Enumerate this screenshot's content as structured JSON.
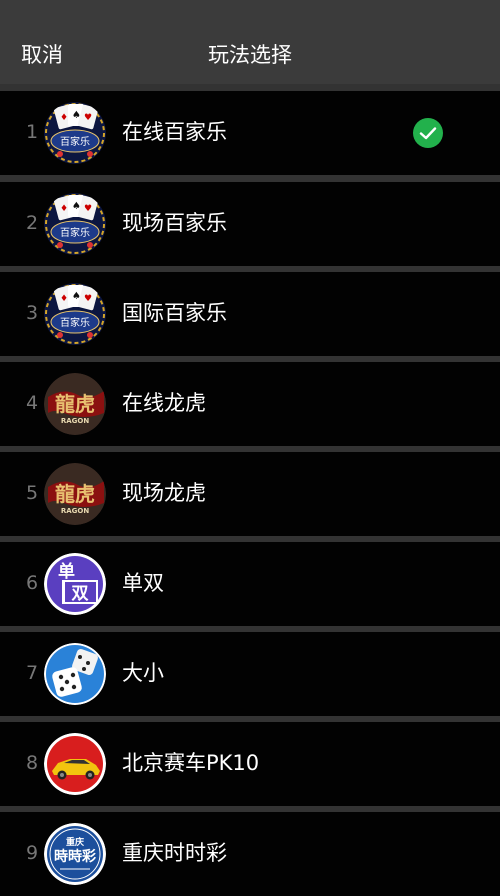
{
  "header": {
    "cancel_label": "取消",
    "title": "玩法选择"
  },
  "accent_color": "#22b14c",
  "items": [
    {
      "index": "1",
      "label": "在线百家乐",
      "icon": "baccarat-icon",
      "selected": true
    },
    {
      "index": "2",
      "label": "现场百家乐",
      "icon": "baccarat-icon",
      "selected": false
    },
    {
      "index": "3",
      "label": "国际百家乐",
      "icon": "baccarat-icon",
      "selected": false
    },
    {
      "index": "4",
      "label": "在线龙虎",
      "icon": "dragon-tiger-icon",
      "selected": false
    },
    {
      "index": "5",
      "label": "现场龙虎",
      "icon": "dragon-tiger-icon",
      "selected": false
    },
    {
      "index": "6",
      "label": "单双",
      "icon": "odd-even-icon",
      "selected": false
    },
    {
      "index": "7",
      "label": "大小",
      "icon": "dice-icon",
      "selected": false
    },
    {
      "index": "8",
      "label": "北京赛车PK10",
      "icon": "race-car-icon",
      "selected": false
    },
    {
      "index": "9",
      "label": "重庆时时彩",
      "icon": "lottery-icon",
      "selected": false
    }
  ],
  "icon_text": {
    "baccarat": "百家乐",
    "dragon_tiger": "龍虎",
    "dragon_tiger_sub": "RAGON",
    "odd": "单",
    "even": "双",
    "lottery_top": "重庆",
    "lottery_main": "時時彩"
  }
}
